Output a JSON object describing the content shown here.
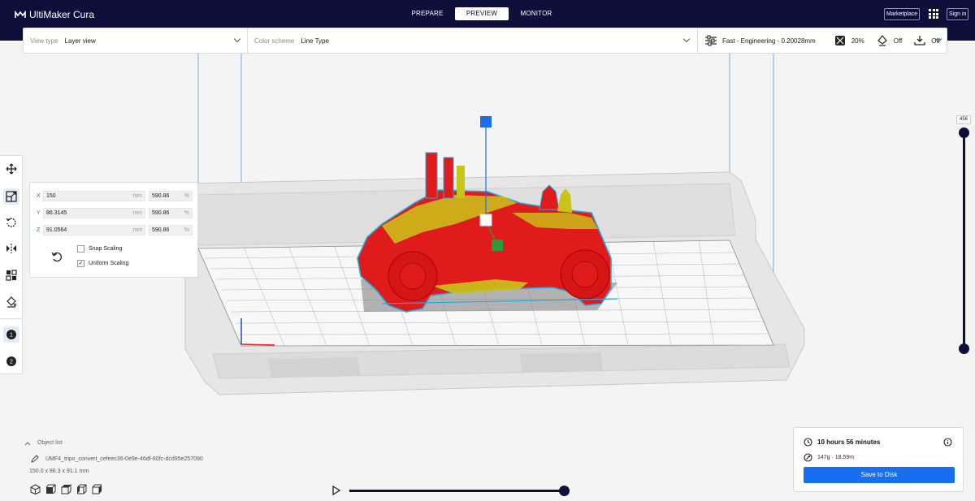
{
  "header": {
    "app_title": "UltiMaker Cura",
    "tabs": [
      {
        "label": "PREPARE",
        "active": false
      },
      {
        "label": "PREVIEW",
        "active": true
      },
      {
        "label": "MONITOR",
        "active": false
      }
    ],
    "marketplace_label": "Marketplace",
    "signin_label": "Sign in"
  },
  "view_bar": {
    "view_type_label": "View type",
    "view_type_value": "Layer view",
    "color_scheme_label": "Color scheme",
    "color_scheme_value": "Line Type",
    "profile": "Fast - Engineering - 0.20028mm",
    "infill": "20%",
    "support": "Off",
    "adhesion": "Off"
  },
  "tools": [
    "move-tool",
    "scale-tool",
    "rotate-tool",
    "mirror-tool",
    "per-model-settings-tool",
    "support-blocker-tool",
    "extruder-1",
    "extruder-2"
  ],
  "extruders": [
    "1",
    "2"
  ],
  "scale_panel": {
    "rows": [
      {
        "axis": "X",
        "mm": "150",
        "pct": "590.86"
      },
      {
        "axis": "Y",
        "mm": "86.3145",
        "pct": "590.86"
      },
      {
        "axis": "Z",
        "mm": "91.0564",
        "pct": "590.86"
      }
    ],
    "mm_unit": "mm",
    "pct_unit": "%",
    "snap_scaling_label": "Snap Scaling",
    "snap_scaling_checked": false,
    "uniform_scaling_label": "Uniform Scaling",
    "uniform_scaling_checked": true
  },
  "layer_slider": {
    "current_layer": "456"
  },
  "object_list": {
    "toggle_label": "Object list",
    "file_name": "UMF4_tripo_convert_cefeec36-0e9e-46df-80fc-dcd95e257090",
    "dimensions": "150.0 x 86.3 x 91.1 mm"
  },
  "summary": {
    "print_time": "10 hours 56 minutes",
    "material": "147g · 18.59m",
    "save_label": "Save to Disk"
  },
  "colors": {
    "header_bg": "#0d0f3b",
    "accent_blue": "#196ef0",
    "model_red": "#e01b1b",
    "model_yellow": "#c9c41a",
    "model_green": "#2a9b3b",
    "outline_cyan": "#25a9e0"
  }
}
